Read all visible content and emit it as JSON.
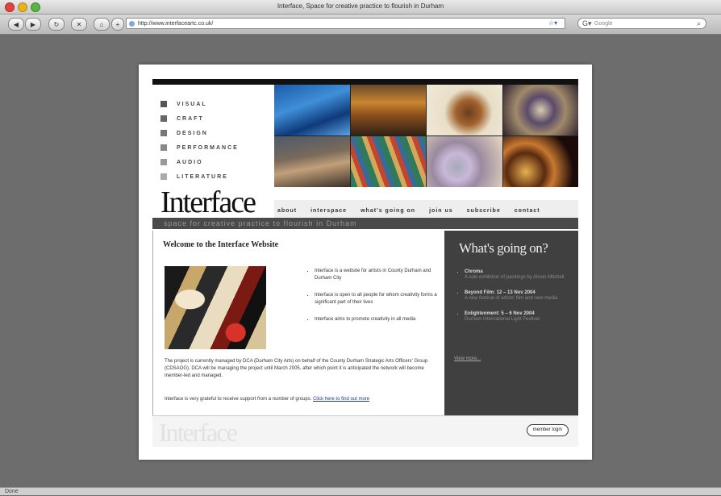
{
  "browser": {
    "window_title": "Interface, Space for creative practice to flourish in Durham",
    "back": "◀",
    "forward": "▶",
    "url": "http://www.interfaceartc.co.uk/",
    "search_placeholder": "Google"
  },
  "site": {
    "disciplines": [
      {
        "label": "VISUAL",
        "color": "#555555"
      },
      {
        "label": "CRAFT",
        "color": "#666666"
      },
      {
        "label": "DESIGN",
        "color": "#777777"
      },
      {
        "label": "PERFORMANCE",
        "color": "#888888"
      },
      {
        "label": "AUDIO",
        "color": "#999999"
      },
      {
        "label": "LITERATURE",
        "color": "#aaaaaa"
      }
    ],
    "logo": "Interface",
    "nav": [
      "about",
      "interspace",
      "what's going on",
      "join us",
      "subscribe",
      "contact"
    ],
    "tagline": "space for creative practice to flourish in Durham",
    "welcome_title": "Welcome to the Interface Website",
    "bullets": [
      "Interface is a website for artists in County Durham and Durham City",
      "Interface is open to all people for whom creativity forms a significant part of their lives",
      "Interface aims to promote creativity in all media"
    ],
    "para1": "The project is currently managed by DCA (Durham City Arts) on behalf of the County Durham Strategic Arts Officers' Group (CDSAOG). DCA will be managing the project until March 2005, after which point it is anticipated the network will become member-led and managed.",
    "para2_text": "Interface is very grateful to receive support from a number of groups.",
    "para2_link": "Click here to find out more",
    "sidebar_title": "What's going on?",
    "events": [
      {
        "title": "Chroma",
        "detail": "A solo exhibition of paintings by Alison Mitchell"
      },
      {
        "title": "Beyond Film: 12 – 13 Nov 2004",
        "detail": "A new festival of artists' film and new media"
      },
      {
        "title": "Enlightenment: 5 – 6 Nov 2004",
        "detail": "Durham International Light Festival"
      }
    ],
    "more_link": "View more...",
    "footer_logo": "Interface",
    "login_button": "member login"
  },
  "status": "Done"
}
